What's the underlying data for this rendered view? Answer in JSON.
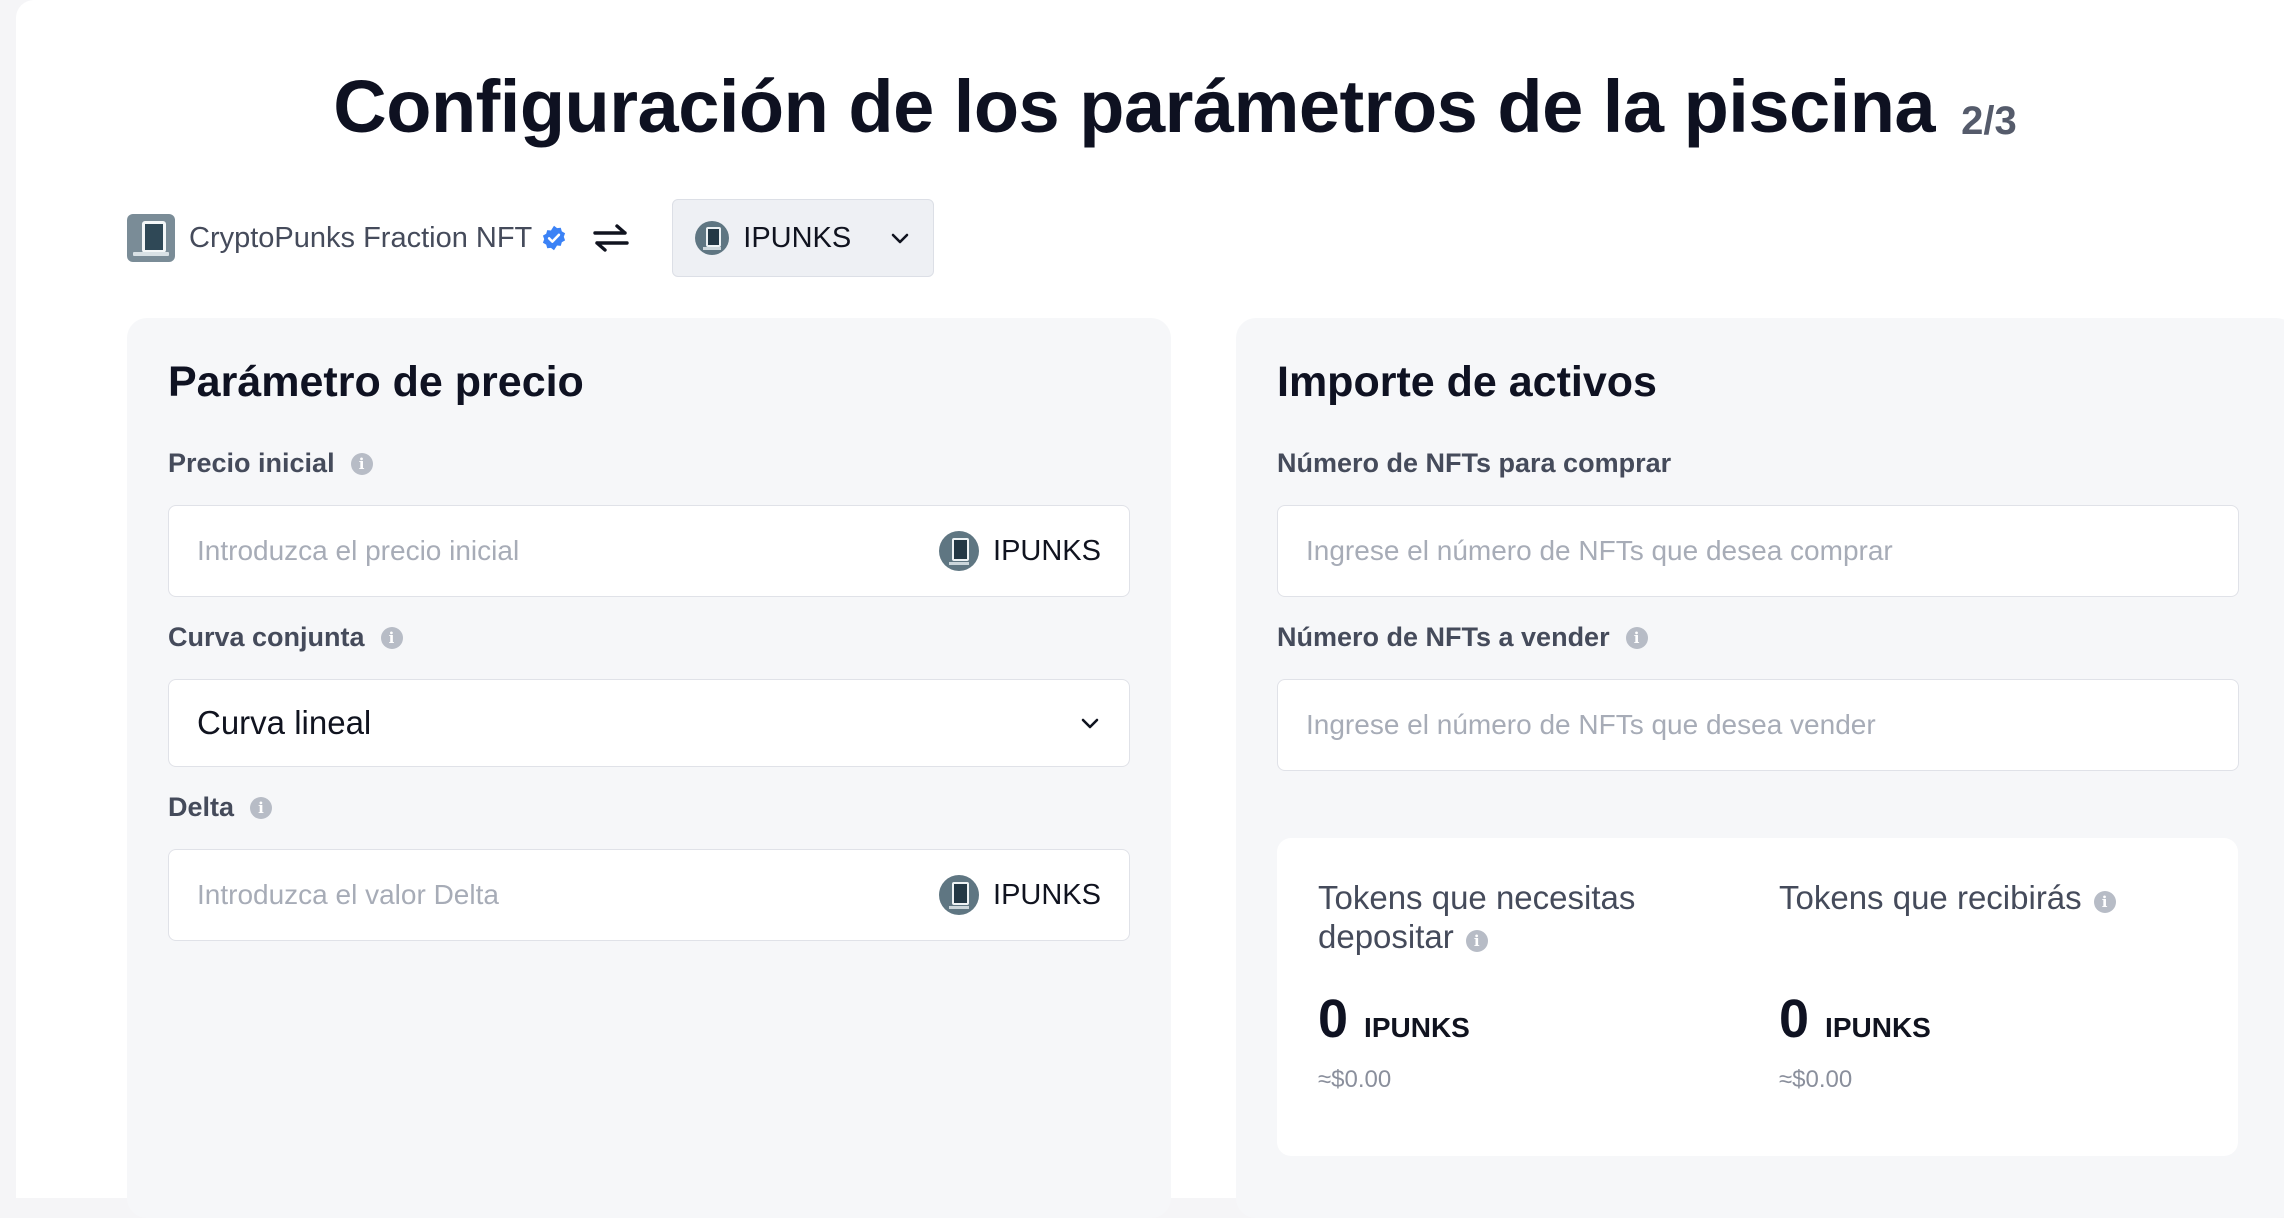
{
  "header": {
    "title": "Configuración de los parámetros de la piscina",
    "step": "2/3"
  },
  "pair": {
    "collection_name": "CryptoPunks Fraction NFT",
    "collection_icon": "cryptopunks-collection-icon",
    "verified_icon": "verified-badge-icon",
    "swap_icon": "swap-arrows-icon",
    "token_selected": "IPUNKS"
  },
  "price_params": {
    "title": "Parámetro de precio",
    "initial_price": {
      "label": "Precio inicial",
      "placeholder": "Introduzca el precio inicial",
      "unit": "IPUNKS"
    },
    "bonding_curve": {
      "label": "Curva conjunta",
      "selected": "Curva lineal"
    },
    "delta": {
      "label": "Delta",
      "placeholder": "Introduzca el valor Delta",
      "unit": "IPUNKS"
    }
  },
  "assets": {
    "title": "Importe de activos",
    "buy_nfts": {
      "label": "Número de NFTs para comprar",
      "placeholder": "Ingrese el número de NFTs que desea comprar"
    },
    "sell_nfts": {
      "label": "Número de NFTs a vender",
      "placeholder": "Ingrese el número de NFTs que desea vender"
    },
    "deposit": {
      "label_line1": "Tokens que necesitas",
      "label_line2": "depositar",
      "amount": "0",
      "unit": "IPUNKS",
      "usd": "≈$0.00"
    },
    "receive": {
      "label": "Tokens que recibirás",
      "amount": "0",
      "unit": "IPUNKS",
      "usd": "≈$0.00"
    }
  },
  "colors": {
    "accent_verified": "#3b82f6",
    "text_primary": "#0f1222",
    "text_secondary": "#454b5b",
    "placeholder": "#a7acb7",
    "card_bg": "#f6f7f9"
  }
}
